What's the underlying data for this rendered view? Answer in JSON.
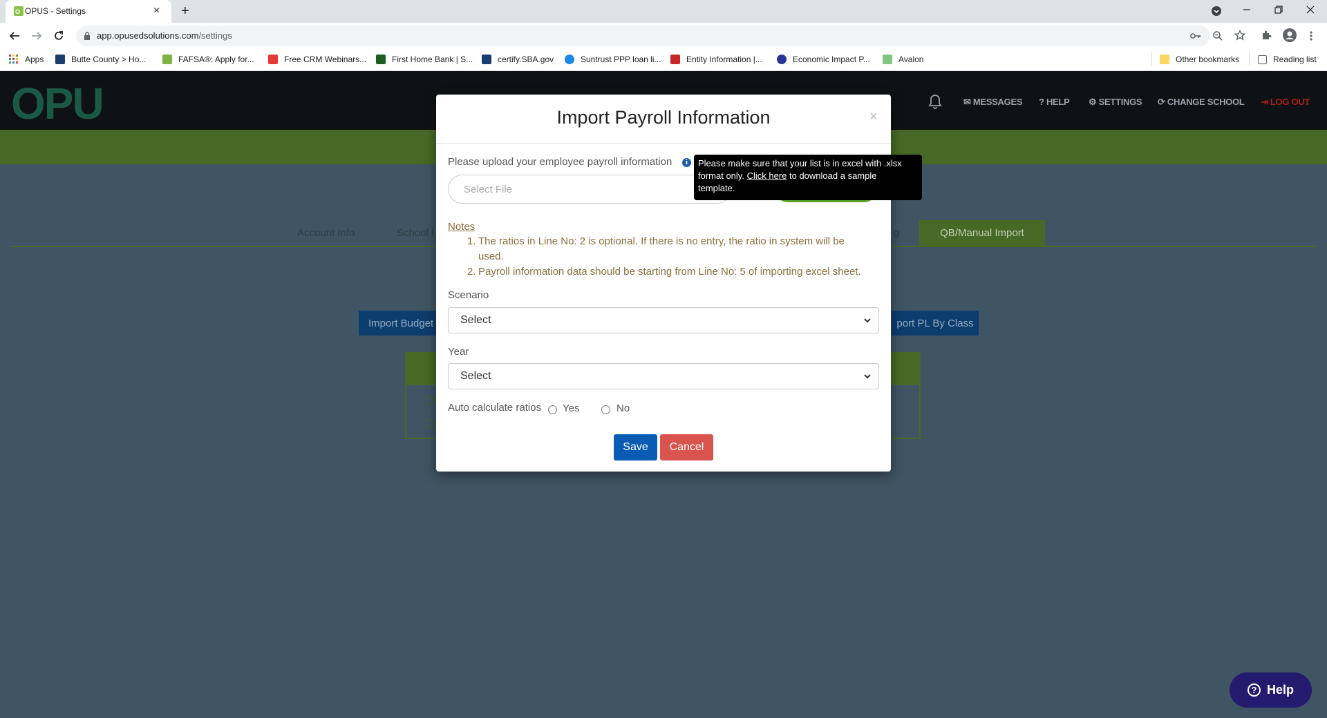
{
  "browser": {
    "tab_title": "OPUS - Settings",
    "url_host": "app.opusedsolutions.com",
    "url_path": "/settings",
    "bookmarks": [
      {
        "label": "Apps",
        "color": "#e53935"
      },
      {
        "label": "Butte County > Ho...",
        "color": "#1a3c6e"
      },
      {
        "label": "FAFSA®: Apply for...",
        "color": "#7cb342"
      },
      {
        "label": "Free CRM Webinars...",
        "color": "#e53935"
      },
      {
        "label": "First Home Bank | S...",
        "color": "#1b5e20"
      },
      {
        "label": "certify.SBA.gov",
        "color": "#1a3c6e"
      },
      {
        "label": "Suntrust PPP loan li...",
        "color": "#1e88e5"
      },
      {
        "label": "Entity Information |...",
        "color": "#c62828"
      },
      {
        "label": "Economic Impact P...",
        "color": "#283593"
      },
      {
        "label": "Avalon",
        "color": "#81c784"
      }
    ],
    "other_bookmarks": "Other bookmarks",
    "reading_list": "Reading list"
  },
  "app": {
    "logo": "OPUS",
    "nav": {
      "messages": "MESSAGES",
      "help": "HELP",
      "settings": "SETTINGS",
      "change_school": "CHANGE SCHOOL",
      "logout": "LOG OUT"
    },
    "tabs": {
      "account_info": "Account Info",
      "school": "School I",
      "partial": "g",
      "qb_manual_import": "QB/Manual Import"
    },
    "buttons": {
      "import_budget": "Import Budget",
      "import_pl_by_class": "port PL By Class"
    },
    "help_fab": "Help"
  },
  "modal": {
    "title": "Import Payroll Information",
    "close": "×",
    "upload_label": "Please upload your employee payroll information",
    "file_placeholder": "Select File",
    "tooltip": {
      "line1": "Please make sure that your list is in excel with .xlsx",
      "line2_pre": "format only.",
      "link": "Click here",
      "line2_post": "to download a sample",
      "line3": "template."
    },
    "notes_heading": "Notes",
    "notes": [
      {
        "num": "1.",
        "line1": "The ratios in Line No: 2 is optional. If there is no entry, the ratio in system will be",
        "line2": "used."
      },
      {
        "num": "2.",
        "line1": "Payroll information data should be starting from Line No: 5 of importing excel sheet."
      }
    ],
    "scenario_label": "Scenario",
    "scenario_value": "Select",
    "year_label": "Year",
    "year_value": "Select",
    "auto_calc_label": "Auto calculate ratios",
    "yes_label": "Yes",
    "no_label": "No",
    "save": "Save",
    "cancel": "Cancel"
  },
  "colors": {
    "overlay_bg": "#3f5563",
    "header_bg": "#0f1214",
    "brand_green": "#466a25",
    "save_blue": "#0a5bb4",
    "cancel_red": "#d9534f",
    "help_fab": "#241b6f"
  }
}
